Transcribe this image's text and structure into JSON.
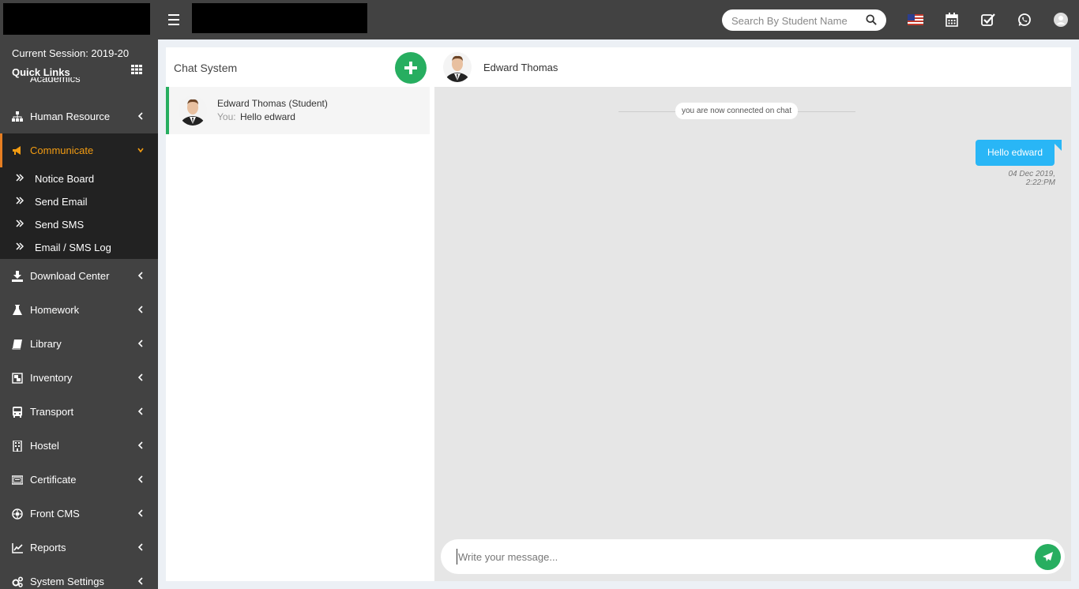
{
  "header": {
    "search_placeholder": "Search By Student Name"
  },
  "sidebar": {
    "session": "Current Session: 2019-20",
    "quick_links": "Quick Links",
    "cut_item": "Academics",
    "items": [
      {
        "label": "Human Resource",
        "icon": "sitemap-icon"
      },
      {
        "label": "Communicate",
        "icon": "bullhorn-icon",
        "active": true
      },
      {
        "label": "Download Center",
        "icon": "download-icon"
      },
      {
        "label": "Homework",
        "icon": "flask-icon"
      },
      {
        "label": "Library",
        "icon": "book-icon"
      },
      {
        "label": "Inventory",
        "icon": "object-group-icon"
      },
      {
        "label": "Transport",
        "icon": "bus-icon"
      },
      {
        "label": "Hostel",
        "icon": "building-icon"
      },
      {
        "label": "Certificate",
        "icon": "certificate-icon"
      },
      {
        "label": "Front CMS",
        "icon": "cog-circle-icon"
      },
      {
        "label": "Reports",
        "icon": "line-chart-icon"
      },
      {
        "label": "System Settings",
        "icon": "gears-icon"
      }
    ],
    "sub_items": [
      {
        "label": "Notice Board"
      },
      {
        "label": "Send Email"
      },
      {
        "label": "Send SMS"
      },
      {
        "label": "Email / SMS Log"
      }
    ]
  },
  "chat_list": {
    "title": "Chat System",
    "contacts": [
      {
        "name": "Edward Thomas (Student)",
        "you_prefix": "You:",
        "last_message": "Hello edward"
      }
    ]
  },
  "conversation": {
    "name": "Edward Thomas",
    "system_notice": "you are now connected on chat",
    "messages": [
      {
        "text": "Hello edward",
        "time": "04 Dec 2019, 2:22:PM"
      }
    ],
    "input_placeholder": "Write your message..."
  },
  "colors": {
    "sidebar_bg": "#424242",
    "active_accent": "#f39c12",
    "green": "#27ae60",
    "bubble": "#29b6f6"
  }
}
